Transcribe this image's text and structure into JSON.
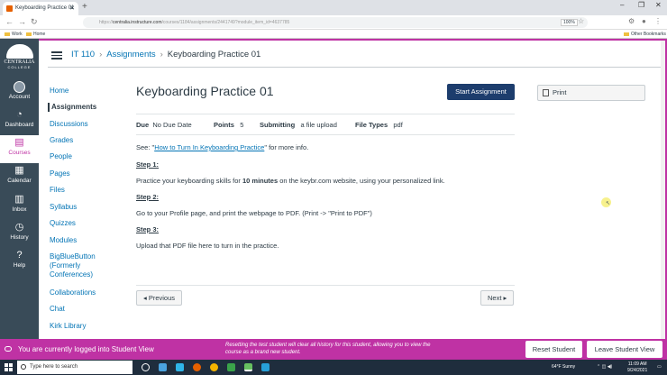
{
  "browser": {
    "tab_title": "Keyboarding Practice 01",
    "url_prefix": "https://",
    "url_host": "centralia.instructure.com",
    "url_path": "/courses/1184/assignments/2441749?module_item_id=4637785",
    "zoom": "100%",
    "bookmarks": [
      "Work",
      "Home"
    ],
    "other_bookmarks": "Other Bookmarks"
  },
  "global_nav": {
    "logo_line1": "CENTRALIA",
    "logo_line2": "COLLEGE",
    "items": [
      {
        "label": "Account",
        "icon": "avatar-icon"
      },
      {
        "label": "Dashboard",
        "icon": "dashboard-icon"
      },
      {
        "label": "Courses",
        "icon": "courses-icon"
      },
      {
        "label": "Calendar",
        "icon": "calendar-icon"
      },
      {
        "label": "Inbox",
        "icon": "inbox-icon"
      },
      {
        "label": "History",
        "icon": "history-icon"
      },
      {
        "label": "Help",
        "icon": "help-icon"
      }
    ]
  },
  "breadcrumb": {
    "course": "IT 110",
    "section": "Assignments",
    "current": "Keyboarding Practice 01"
  },
  "course_nav": [
    "Home",
    "Assignments",
    "Discussions",
    "Grades",
    "People",
    "Pages",
    "Files",
    "Syllabus",
    "Quizzes",
    "Modules",
    "BigBlueButton",
    "(Formerly",
    "Conferences)",
    "Collaborations",
    "Chat",
    "Kirk Library"
  ],
  "assignment": {
    "title": "Keyboarding Practice 01",
    "start_button": "Start Assignment",
    "due_label": "Due",
    "due_value": "No Due Date",
    "points_label": "Points",
    "points_value": "5",
    "submitting_label": "Submitting",
    "submitting_value": "a file upload",
    "filetypes_label": "File Types",
    "filetypes_value": "pdf",
    "see_prefix": "See: \"",
    "see_link": "How to Turn In Keyboarding Practice",
    "see_suffix": "\" for more info.",
    "step1": "Step 1:",
    "step1_pre": "Practice your keyboarding skills for ",
    "step1_bold": "10 minutes",
    "step1_post": " on the keybr.com website, using your personalized link.",
    "step2": "Step 2:",
    "step2_text": "Go to your Profile page, and print the webpage to PDF. (Print -> \"Print to PDF\")",
    "step3": "Step 3:",
    "step3_text": "Upload that PDF file here to turn in the practice.",
    "prev": "◂ Previous",
    "next": "Next ▸",
    "print": "Print"
  },
  "student_view": {
    "message": "You are currently logged into Student View",
    "warning": "Resetting the test student will clear all history for this student, allowing you to view the course as a brand new student.",
    "reset": "Reset Student",
    "leave": "Leave Student View"
  },
  "taskbar": {
    "search_placeholder": "Type here to search",
    "weather": "64°F  Sunny",
    "time": "11:09 AM",
    "date": "9/24/2021"
  },
  "colors": {
    "accent": "#bf32a4",
    "nav_bg": "#394b58",
    "link": "#0374b5",
    "primary_button": "#1d3d6d"
  }
}
